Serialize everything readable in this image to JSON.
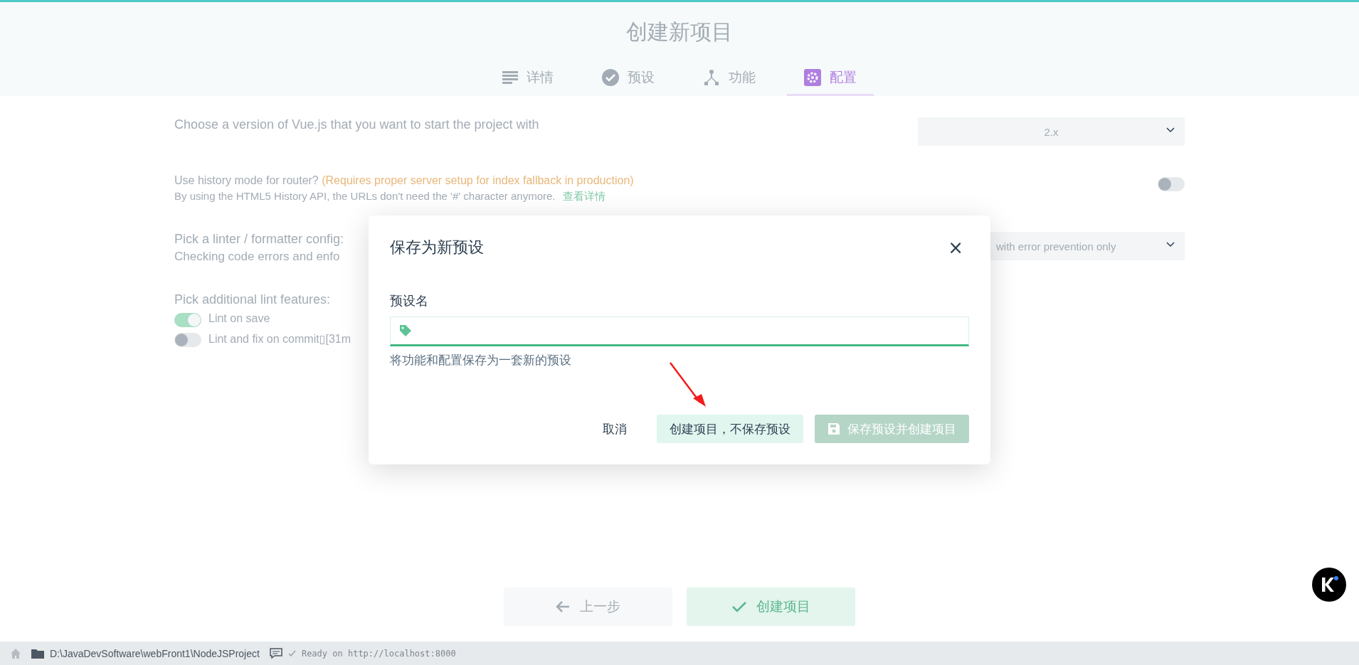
{
  "header": {
    "title": "创建新项目",
    "tabs": [
      {
        "label": "详情",
        "selected": false
      },
      {
        "label": "预设",
        "selected": false
      },
      {
        "label": "功能",
        "selected": false
      },
      {
        "label": "配置",
        "selected": true
      }
    ]
  },
  "form": [
    {
      "kind": "select",
      "label": "Choose a version of Vue.js that you want to start the project with",
      "value": "2.x"
    },
    {
      "kind": "switch",
      "label": "Use history mode for router?",
      "note": "(Requires proper server setup for index fallback in production)",
      "description": "By using the HTML5 History API, the URLs don't need the '#' character anymore.",
      "link": "查看详情",
      "on": false
    },
    {
      "kind": "select",
      "label": "Pick a linter / formatter config:",
      "description": "Checking code errors and enfo",
      "value": "with error prevention only"
    },
    {
      "kind": "options",
      "label": "Pick additional lint features:",
      "options": [
        {
          "label": "Lint on save",
          "on": true
        },
        {
          "label": "Lint and fix on commit▯[31m",
          "on": false
        }
      ]
    }
  ],
  "footer": {
    "back": "上一步",
    "create": "创建项目"
  },
  "status_bar": {
    "path": "D:\\JavaDevSoftware\\webFront1\\NodeJSProject",
    "message": "Ready on http://localhost:8000"
  },
  "dialog": {
    "title": "保存为新预设",
    "close": "×",
    "field_label": "预设名",
    "hint": "将功能和配置保存为一套新的预设",
    "buttons": [
      {
        "kind": "flat",
        "label": "取消"
      },
      {
        "kind": "light",
        "label": "创建项目，不保存预设"
      },
      {
        "kind": "primary",
        "label": "保存预设并创建项目",
        "disabled": true
      }
    ]
  }
}
